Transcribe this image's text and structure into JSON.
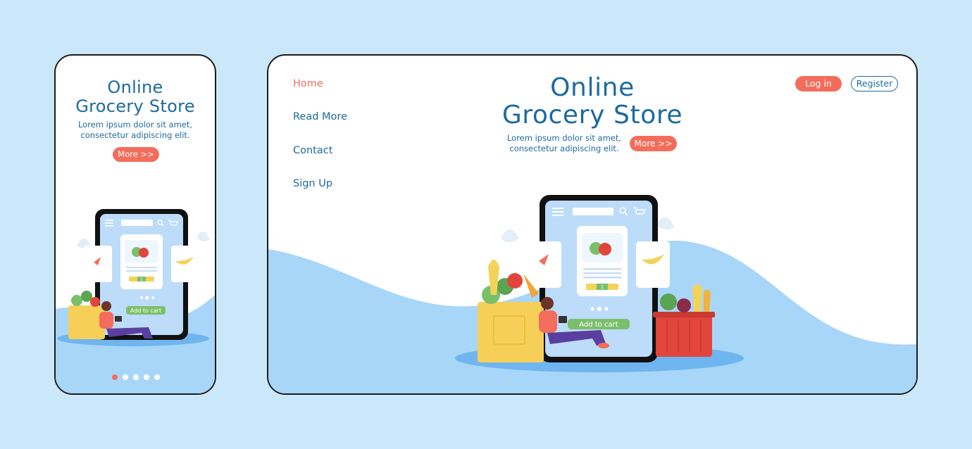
{
  "mobile": {
    "title_line1": "Online",
    "title_line2": "Grocery Store",
    "subtitle_line1": "Lorem ipsum dolor sit amet,",
    "subtitle_line2": "consectetur adipiscing elit.",
    "more_label": "More >>",
    "add_to_cart_label": "Add to cart",
    "stepper_value": "1",
    "active_page": 1,
    "page_count": 5
  },
  "desktop": {
    "nav": [
      {
        "label": "Home",
        "active": true
      },
      {
        "label": "Read More",
        "active": false
      },
      {
        "label": "Contact",
        "active": false
      },
      {
        "label": "Sign Up",
        "active": false
      }
    ],
    "title_line1": "Online",
    "title_line2": "Grocery Store",
    "subtitle_line1": "Lorem ipsum dolor sit amet,",
    "subtitle_line2": "consectetur adipiscing elit.",
    "more_label": "More >>",
    "login_label": "Log in",
    "register_label": "Register",
    "add_to_cart_label": "Add to cart",
    "stepper_value": "1"
  },
  "colors": {
    "background": "#cbe8fb",
    "accent": "#f26d5b",
    "brand_blue": "#1c6aa0",
    "wave_blue": "#9fd0f6",
    "cart_green": "#7cbf6b"
  },
  "icons": [
    "menu-icon",
    "search-icon",
    "cart-icon",
    "carrot-icon",
    "apple-icon",
    "banana-icon"
  ]
}
